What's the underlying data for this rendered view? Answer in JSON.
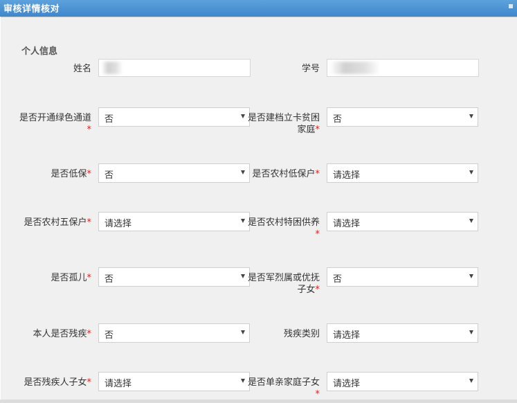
{
  "window": {
    "title": "审核详情核对"
  },
  "section": {
    "title": "个人信息"
  },
  "fields": {
    "name": {
      "label": "姓名",
      "value": ""
    },
    "student_id": {
      "label": "学号",
      "value": ""
    },
    "green_channel": {
      "label": "是否开通绿色通道",
      "required": "*",
      "value": "否"
    },
    "poverty_family": {
      "label": "是否建档立卡贫困家庭",
      "required": "*",
      "value": "否"
    },
    "low_income": {
      "label": "是否低保",
      "required": "*",
      "value": "否"
    },
    "rural_low_income": {
      "label": "是否农村低保户",
      "required": "*",
      "value": "请选择"
    },
    "rural_five_guarantee": {
      "label": "是否农村五保户",
      "required": "*",
      "value": "请选择"
    },
    "rural_special_support": {
      "label": "是否农村特困供养",
      "required": "*",
      "value": "请选择"
    },
    "orphan": {
      "label": "是否孤儿",
      "required": "*",
      "value": "否"
    },
    "martyr_family": {
      "label": "是否军烈属或优抚子女",
      "required": "*",
      "value": "否"
    },
    "disabled": {
      "label": "本人是否残疾",
      "required": "*",
      "value": "否"
    },
    "disability_type": {
      "label": "残疾类别",
      "value": "请选择"
    },
    "disabled_parent_child": {
      "label": "是否残疾人子女",
      "required": "*",
      "value": "请选择"
    },
    "single_parent": {
      "label": "是否单亲家庭子女",
      "required": "*",
      "value": "请选择"
    }
  },
  "colors": {
    "titlebar": "#4a90d4",
    "body_bg": "#f0f0f0",
    "required": "#e02020"
  },
  "icons": {
    "close": "close-icon",
    "dropdown": "chevron-down-icon"
  }
}
